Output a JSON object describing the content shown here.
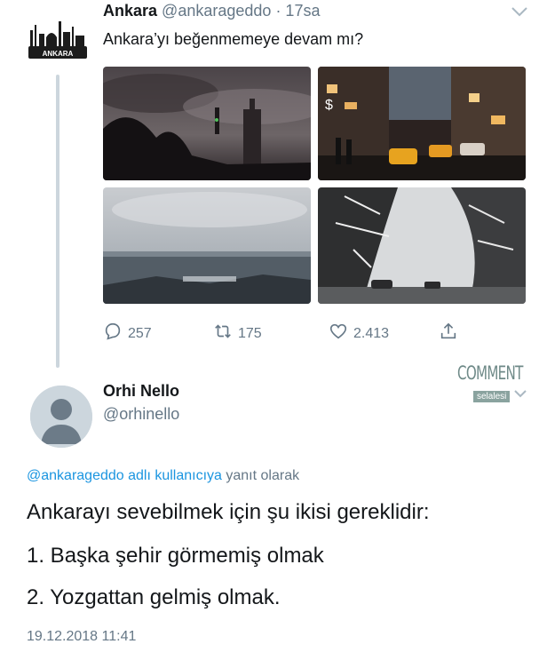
{
  "original_tweet": {
    "account_name": "Ankara",
    "handle": "@ankarageddo",
    "time_ago": "· 17sa",
    "avatar_logo_text": "ANKARA",
    "text": "Ankara’yı beğenmemeye devam mı?",
    "actions": {
      "replies": "257",
      "retweets": "175",
      "likes": "2.413"
    }
  },
  "reply_tweet": {
    "name": "Orhi Nello",
    "handle": "@orhinello",
    "reply_to_link": "@ankarageddo adlı kullanıcıya",
    "reply_to_suffix": " yanıt olarak",
    "lines": [
      "Ankarayı sevebilmek için şu ikisi gereklidir:",
      "1. Başka şehir görmemiş olmak",
      "2. Yozgattan gelmiş olmak."
    ],
    "timestamp": "19.12.2018 11:41"
  },
  "watermark": {
    "top": "COMMENT",
    "bottom": "selalesi"
  },
  "icons": [
    "chevron-down-icon",
    "reply-icon",
    "retweet-icon",
    "like-icon",
    "share-icon"
  ],
  "colors": {
    "text": "#14171a",
    "secondary": "#657786",
    "link": "#1b95e0",
    "thread_line": "#ccd6dd"
  }
}
